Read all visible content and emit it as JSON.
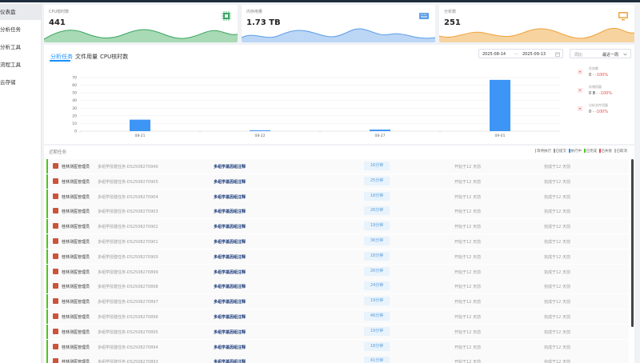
{
  "sidebar": {
    "items": [
      {
        "label": "仪表盘",
        "active": true
      },
      {
        "label": "分析任务",
        "active": false
      },
      {
        "label": "分析工具",
        "active": false
      },
      {
        "label": "流程工具",
        "active": false
      },
      {
        "label": "云存储",
        "active": false
      }
    ]
  },
  "stats": [
    {
      "label": "CPU核时数",
      "value": "441",
      "icon": "cpu-chip-icon",
      "color": "#3aa55f"
    },
    {
      "label": "内存用量",
      "value": "1.73 TB",
      "icon": "memory-icon",
      "color": "#5b9ee8"
    },
    {
      "label": "分析数",
      "value": "251",
      "icon": "monitor-icon",
      "color": "#f0a23a"
    }
  ],
  "tabs": [
    {
      "label": "分析任务",
      "active": true
    },
    {
      "label": "文件用量",
      "active": false
    },
    {
      "label": "CPU核时数",
      "active": false
    }
  ],
  "date_range": {
    "start": "2025-08-14",
    "separator": "—",
    "end": "2025-09-13",
    "icon": "calendar-icon"
  },
  "period_select": {
    "label": "周比",
    "value": "最近一周",
    "icon": "chevron-down-icon"
  },
  "chart_data": {
    "type": "bar",
    "categories": [
      "08-21",
      "08-22",
      "08-27",
      "09-01"
    ],
    "values": [
      15,
      1,
      2,
      67
    ],
    "ylim": [
      0,
      70
    ],
    "yticks": [
      0,
      10,
      20,
      30,
      40,
      50,
      60,
      70
    ],
    "grid": true,
    "color": "#3d95f5"
  },
  "summary": [
    {
      "name": "任务数",
      "value": "0",
      "change": "-100%"
    },
    {
      "name": "存储用量",
      "value": "0 B",
      "change": "-100%"
    },
    {
      "name": "分析文件用量",
      "value": "0",
      "change": "-100%"
    }
  ],
  "list": {
    "title": "近期任务",
    "statuses": [
      {
        "label": "等待执行",
        "color": "#f0a23a"
      },
      {
        "label": "已提交",
        "color": "#999999"
      },
      {
        "label": "执行中",
        "color": "#1890ff"
      },
      {
        "label": "已完成",
        "color": "#52c41a"
      },
      {
        "label": "已失败",
        "color": "#e84a4a"
      },
      {
        "label": "已取消",
        "color": "#bbbbbb"
      }
    ],
    "rows": [
      {
        "owner": "桂林测医管理员",
        "task": "多组学授建任务-DS2508270940",
        "type": "多组学基因组注释",
        "duration": "16分钟",
        "start": "开始于12 天前",
        "end": "完成于12 天前"
      },
      {
        "owner": "桂林测医管理员",
        "task": "多组学授建任务-DS2508270905",
        "type": "多组学基因组注释",
        "duration": "25分钟",
        "start": "开始于12 天前",
        "end": "完成于12 天前"
      },
      {
        "owner": "桂林测医管理员",
        "task": "多组学授建任务-DS2508270904",
        "type": "多组学基因组注释",
        "duration": "18分钟",
        "start": "开始于12 天前",
        "end": "完成于12 天前"
      },
      {
        "owner": "桂林测医管理员",
        "task": "多组学授建任务-DS2508270903",
        "type": "多组学基因组注释",
        "duration": "26分钟",
        "start": "开始于12 天前",
        "end": "完成于12 天前"
      },
      {
        "owner": "桂林测医管理员",
        "task": "多组学授建任务-DS2508270902",
        "type": "多组学基因组注释",
        "duration": "19分钟",
        "start": "开始于12 天前",
        "end": "完成于12 天前"
      },
      {
        "owner": "桂林测医管理员",
        "task": "多组学授建任务-DS2508270901",
        "type": "多组学基因组注释",
        "duration": "36分钟",
        "start": "开始于12 天前",
        "end": "完成于12 天前"
      },
      {
        "owner": "桂林测医管理员",
        "task": "多组学授建任务-DS2508270900",
        "type": "多组学基因组注释",
        "duration": "18分钟",
        "start": "开始于12 天前",
        "end": "完成于12 天前"
      },
      {
        "owner": "桂林测医管理员",
        "task": "多组学授建任务-DS2508270899",
        "type": "多组学基因组注释",
        "duration": "26分钟",
        "start": "开始于12 天前",
        "end": "完成于12 天前"
      },
      {
        "owner": "桂林测医管理员",
        "task": "多组学授建任务-DS2508270898",
        "type": "多组学基因组注释",
        "duration": "24分钟",
        "start": "开始于12 天前",
        "end": "完成于12 天前"
      },
      {
        "owner": "桂林测医管理员",
        "task": "多组学授建任务-DS2508270897",
        "type": "多组学基因组注释",
        "duration": "19分钟",
        "start": "开始于12 天前",
        "end": "完成于12 天前"
      },
      {
        "owner": "桂林测医管理员",
        "task": "多组学授建任务-DS2508270896",
        "type": "多组学基因组注释",
        "duration": "46分钟",
        "start": "开始于12 天前",
        "end": "完成于12 天前"
      },
      {
        "owner": "桂林测医管理员",
        "task": "多组学授建任务-DS2508270895",
        "type": "多组学基因组注释",
        "duration": "19分钟",
        "start": "开始于12 天前",
        "end": "完成于12 天前"
      },
      {
        "owner": "桂林测医管理员",
        "task": "多组学授建任务-DS2508270894",
        "type": "多组学基因组注释",
        "duration": "18分钟",
        "start": "开始于12 天前",
        "end": "完成于12 天前"
      },
      {
        "owner": "桂林测医管理员",
        "task": "多组学授建任务-DS2508270893",
        "type": "多组学基因组注释",
        "duration": "41分钟",
        "start": "开始于12 天前",
        "end": "完成于12 天前"
      }
    ]
  }
}
